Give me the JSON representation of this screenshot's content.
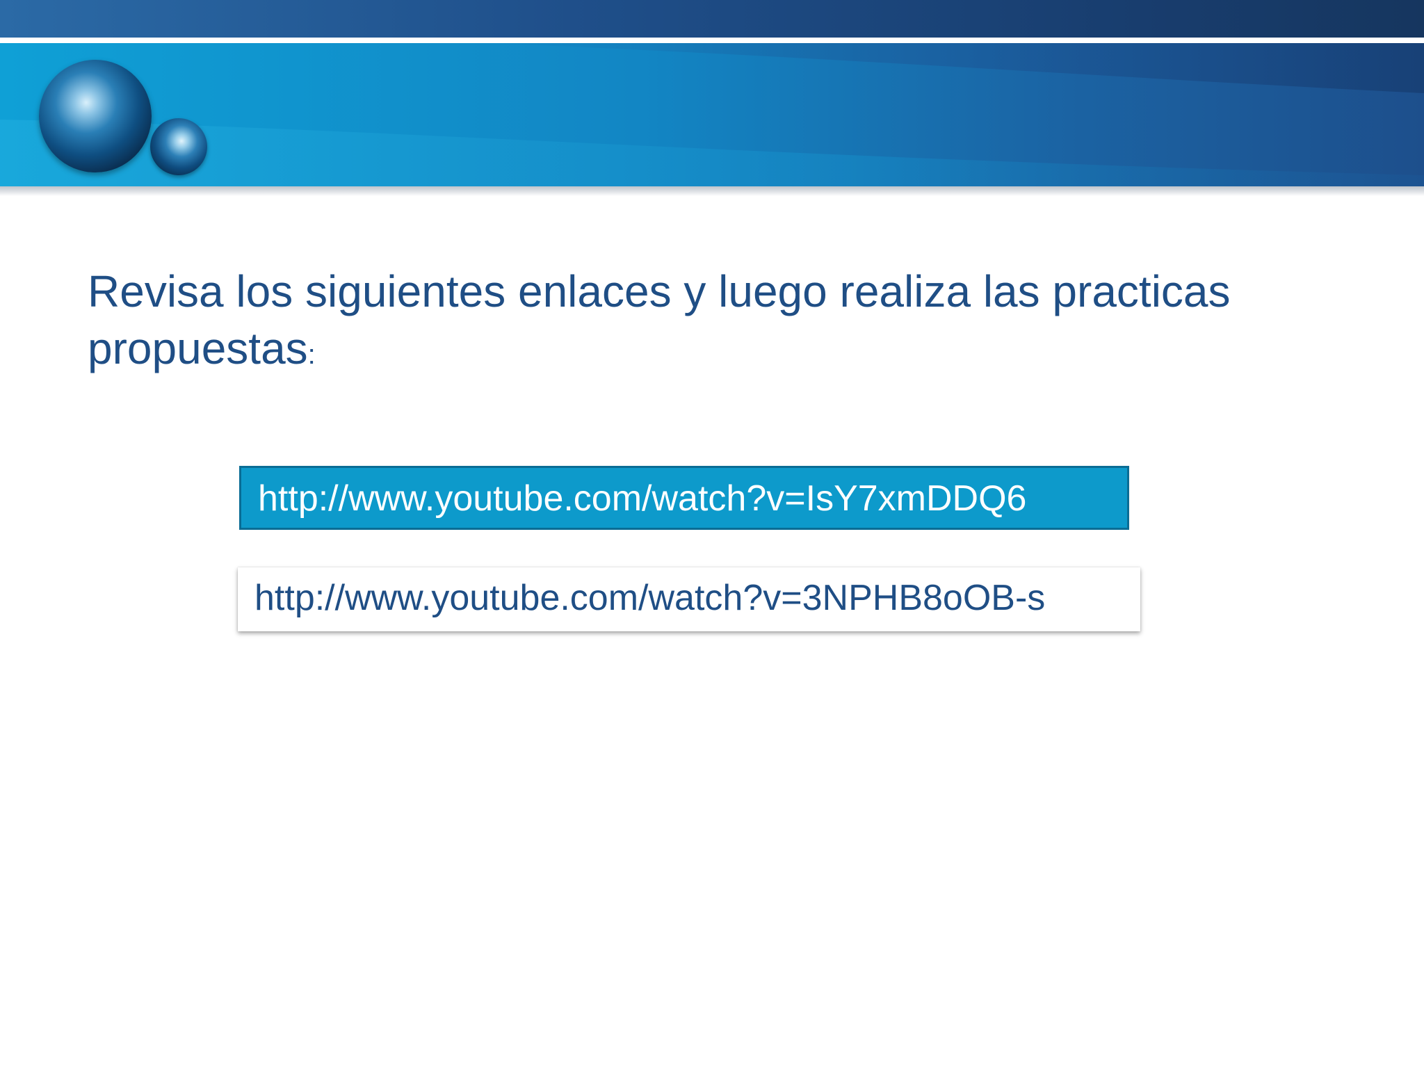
{
  "slide": {
    "heading_line": "Revisa los siguientes enlaces y luego realiza las practicas propuestas",
    "heading_colon": ":",
    "links": [
      {
        "text": "http://www.youtube.com/watch?v=IsY7xmDDQ6"
      },
      {
        "text": "http://www.youtube.com/watch?v=3NPHB8oOB-s"
      }
    ]
  },
  "colors": {
    "heading_text": "#1f4e85",
    "primary_link_bg": "#0d9acb",
    "primary_link_border": "#0b6d95",
    "banner_dark": "#1f4f8a",
    "banner_light": "#0f9ad0"
  }
}
